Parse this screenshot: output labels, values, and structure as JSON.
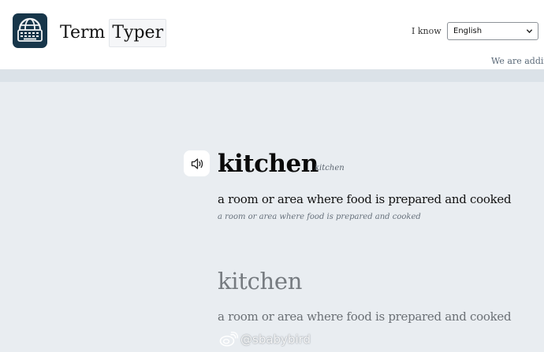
{
  "header": {
    "brand_part1": "Term",
    "brand_part2": "Typer",
    "i_know_label": "I know",
    "language_selected": "English",
    "notice_text": "We are adding"
  },
  "entry": {
    "word": "kitchen",
    "phonetic": "kitchen",
    "definition": "a room or area where food is prepared and cooked",
    "definition_sub": "a room or area where food is prepared and cooked"
  },
  "typing": {
    "word_prompt": "kitchen",
    "definition_prompt": "a room or area where food is prepared and cooked"
  },
  "watermark": {
    "text": "@sbabybird"
  },
  "colors": {
    "logo_bg": "#17364a",
    "page_bg": "#e9edf1",
    "header_bg": "#ffffff"
  },
  "icons": {
    "logo": "keyboard-globe-icon",
    "sound": "speaker-icon",
    "select": "chevron-down-icon",
    "watermark": "weibo-icon"
  }
}
